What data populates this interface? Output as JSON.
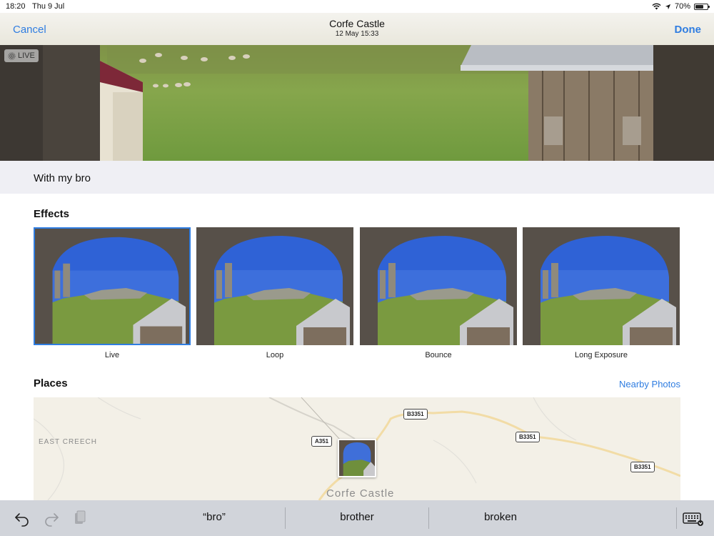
{
  "status_bar": {
    "time": "18:20",
    "date": "Thu 9 Jul",
    "battery": "70%",
    "battery_level": 0.7
  },
  "nav": {
    "cancel": "Cancel",
    "title": "Corfe Castle",
    "subtitle": "12 May  15:33",
    "done": "Done"
  },
  "hero": {
    "live_badge": "LIVE"
  },
  "caption": "With my bro",
  "effects": {
    "title": "Effects",
    "items": [
      {
        "label": "Live",
        "selected": true
      },
      {
        "label": "Loop",
        "selected": false
      },
      {
        "label": "Bounce",
        "selected": false
      },
      {
        "label": "Long Exposure",
        "selected": false
      }
    ]
  },
  "places": {
    "title": "Places",
    "nearby_link": "Nearby Photos",
    "map": {
      "roads": [
        "A351",
        "B3351",
        "B3351",
        "B3351"
      ],
      "area_label": "EAST CREECH",
      "town_label": "Corfe Castle"
    }
  },
  "keyboard_bar": {
    "suggestions": [
      "“bro”",
      "brother",
      "broken"
    ],
    "icons": [
      "undo-icon",
      "redo-icon",
      "paste-icon",
      "keyboard-icon"
    ]
  },
  "colors": {
    "accent": "#2f7de1",
    "band": "#efeff4",
    "keyboard_bar": "#d1d4da"
  }
}
